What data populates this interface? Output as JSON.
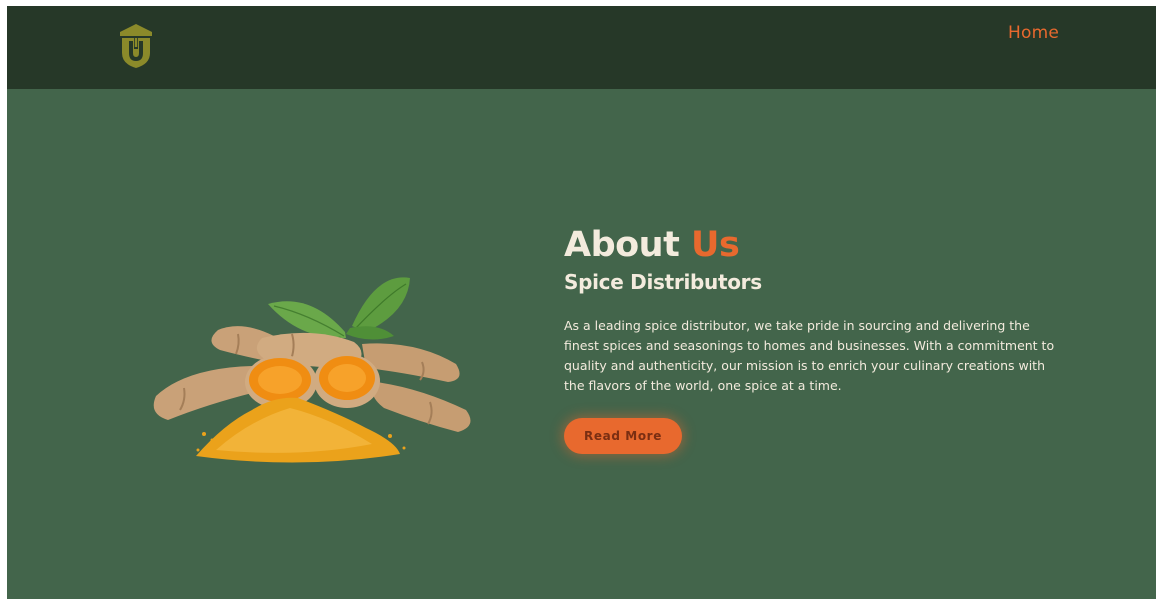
{
  "nav": {
    "logo_icon": "shield-logo-icon",
    "home_label": "Home"
  },
  "hero": {
    "image_icon": "turmeric-image",
    "title_main": "About",
    "title_accent": "Us",
    "subtitle": "Spice Distributors",
    "description": "As a leading spice distributor, we take pride in sourcing and delivering the finest spices and seasonings to homes and businesses. With a commitment to quality and authenticity, our mission is to enrich your culinary creations with the flavors of the world, one spice at a time.",
    "button_label": "Read More"
  },
  "colors": {
    "background": "#43654b",
    "navbar": "#263828",
    "accent": "#e8692e",
    "text": "#f3ebdd",
    "logo": "#8b8a2a"
  }
}
